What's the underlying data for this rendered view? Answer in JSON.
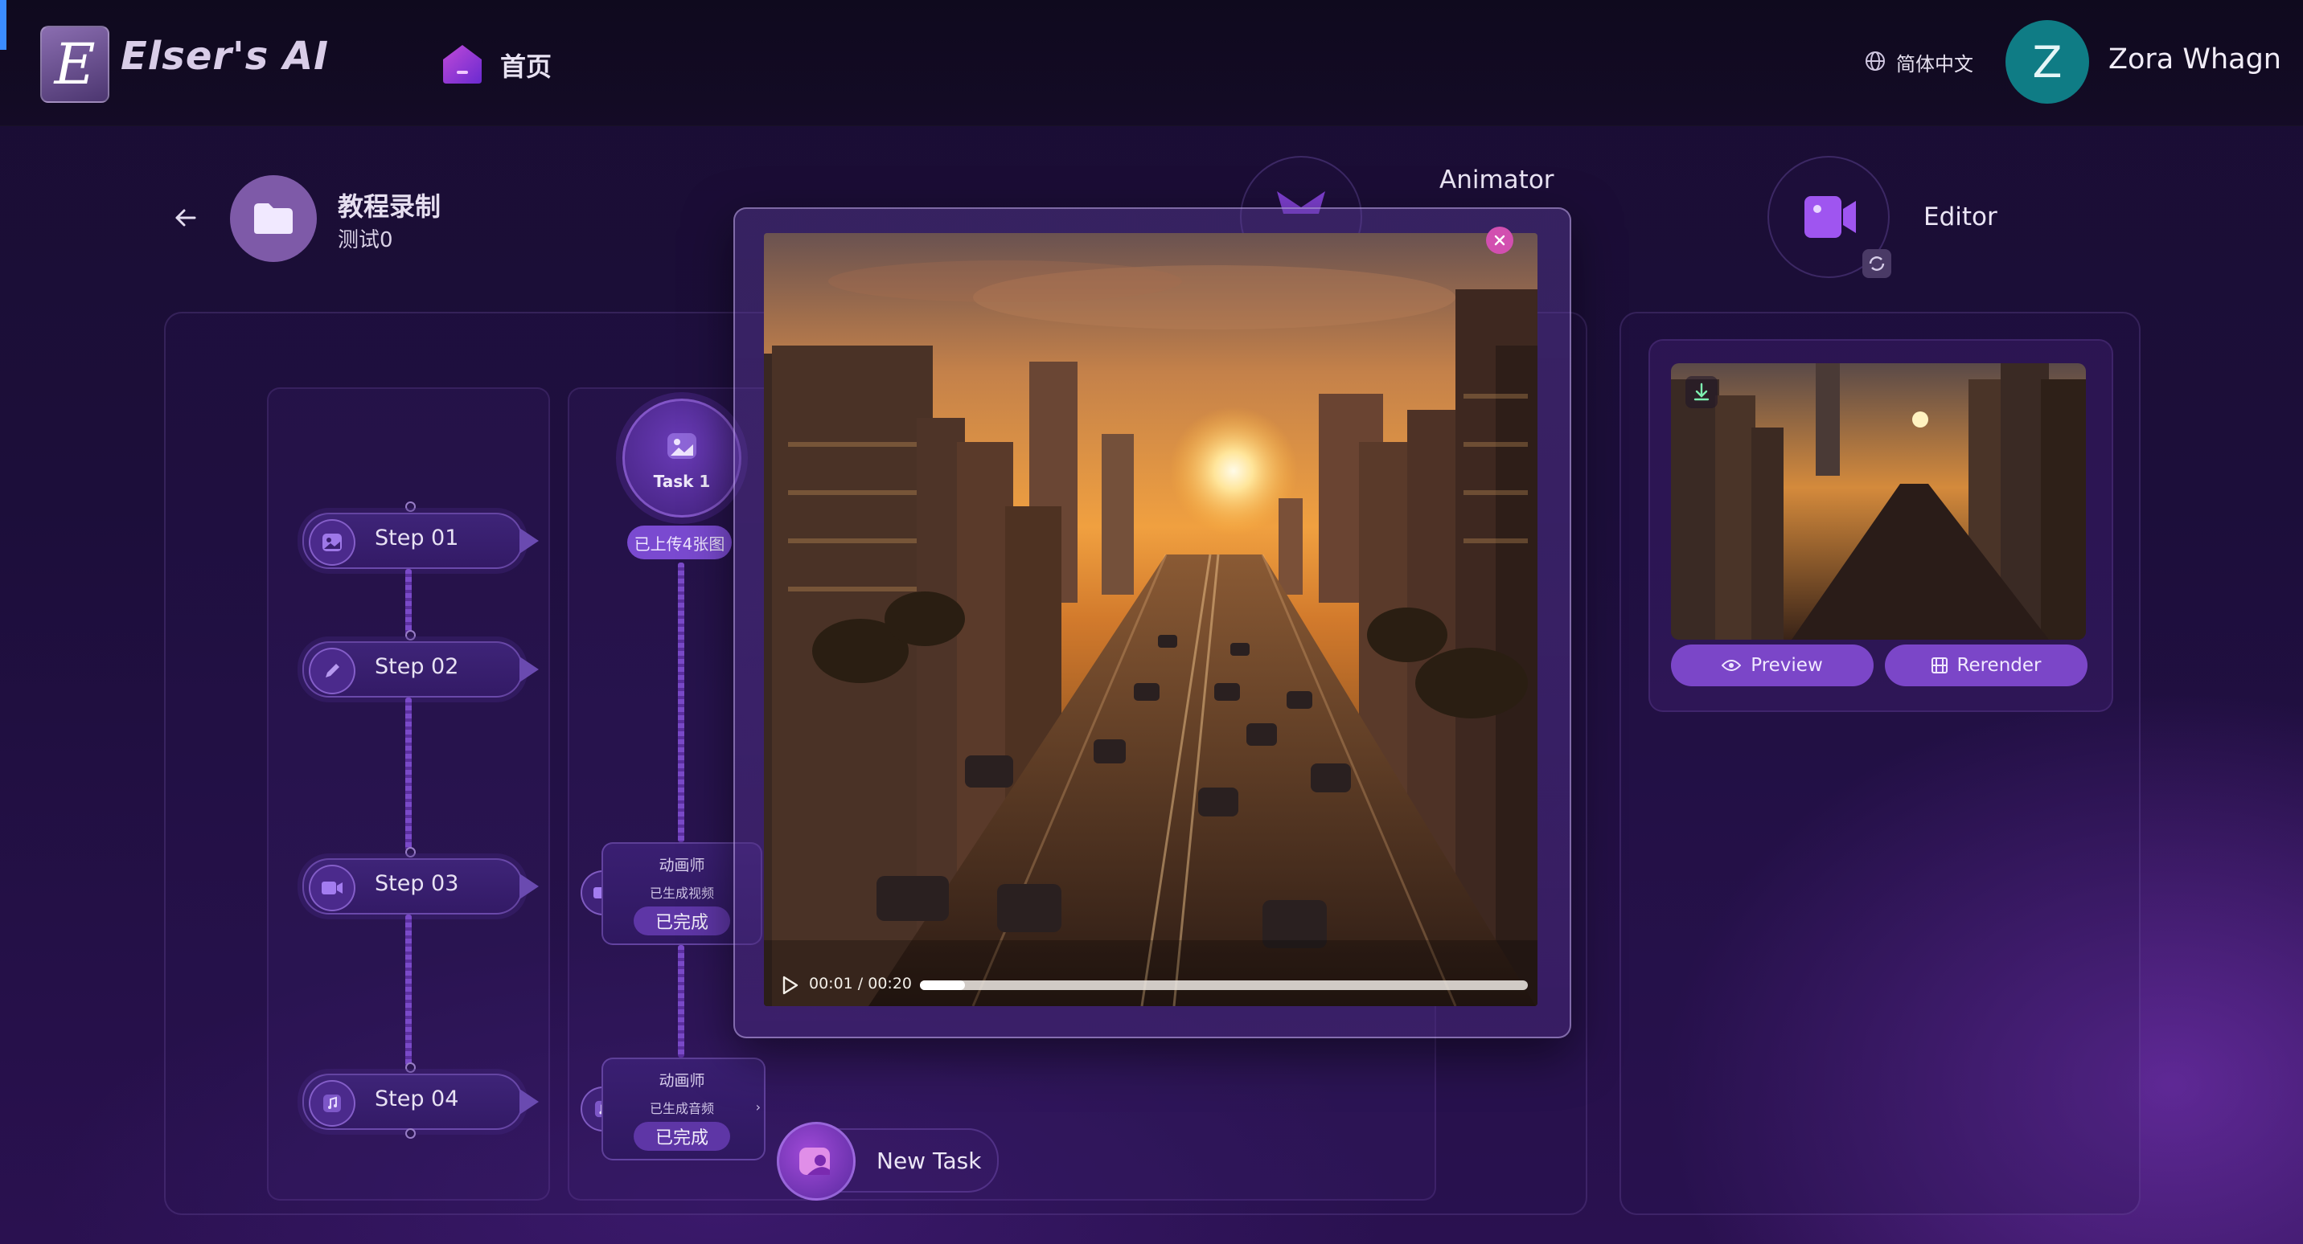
{
  "app": {
    "brand": "Elser's AI",
    "logo_letter": "E",
    "nav_home": "首页",
    "language": "简体中文",
    "user_initial": "Z",
    "user_name": "Zora Whagn"
  },
  "project": {
    "title": "教程录制",
    "subtitle": "测试0"
  },
  "stages": {
    "animator": "Animator",
    "editor": "Editor"
  },
  "steps": [
    {
      "label": "Step 01",
      "icon": "image-icon"
    },
    {
      "label": "Step 02",
      "icon": "pen-icon"
    },
    {
      "label": "Step 03",
      "icon": "video-icon"
    },
    {
      "label": "Step 04",
      "icon": "music-icon"
    }
  ],
  "task": {
    "name": "Task 1",
    "uploaded": "已上传4张图",
    "cards": [
      {
        "role": "动画师",
        "status": "已生成视频",
        "state": "已完成",
        "icon": "video-icon"
      },
      {
        "role": "动画师",
        "status": "已生成音频",
        "state": "已完成",
        "icon": "music-icon"
      }
    ],
    "new_task": "New Task"
  },
  "editor_card": {
    "preview": "Preview",
    "rerender": "Rerender"
  },
  "player": {
    "time": "00:01 / 00:20",
    "progress": 0.07
  },
  "colors": {
    "accent": "#7b46c8",
    "avatar": "#0f7c85",
    "close": "#d24fb0"
  }
}
